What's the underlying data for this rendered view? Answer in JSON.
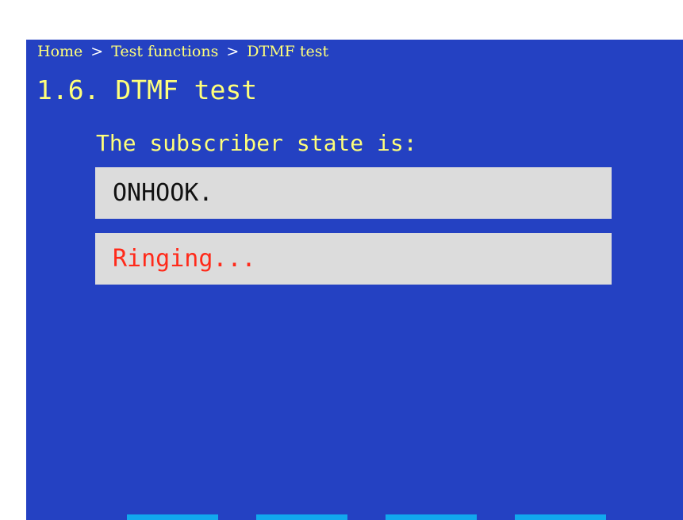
{
  "breadcrumb": {
    "items": [
      "Home",
      "Test functions",
      "DTMF test"
    ],
    "separator": ">"
  },
  "page_title": "1.6. DTMF test",
  "state_label": "The subscriber state is:",
  "subscriber_state": "ONHOOK.",
  "call_status": "Ringing...",
  "colors": {
    "screen_background": "#2441c2",
    "header_text": "#ffff7a",
    "field_background": "#dcdcdc",
    "status_text": "#ff2a1a",
    "softkey": "#11a8ee"
  }
}
